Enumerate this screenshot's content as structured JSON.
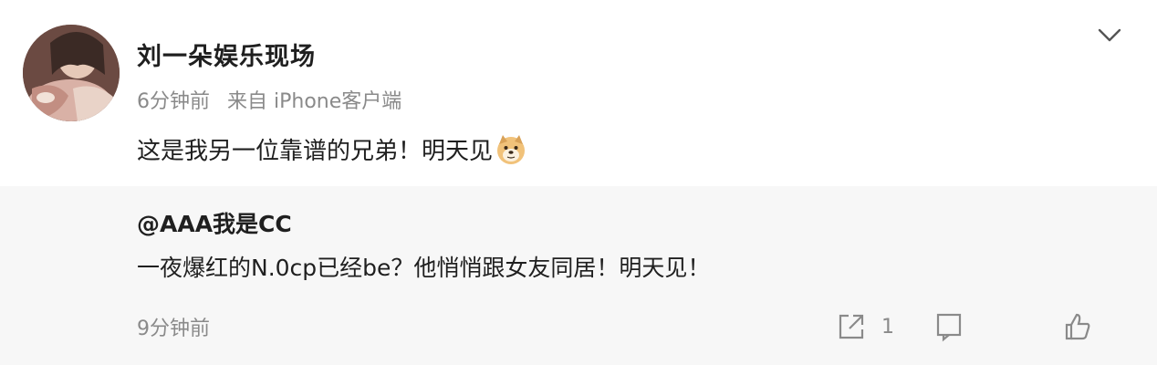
{
  "post": {
    "author": "刘一朵娱乐现场",
    "time": "6分钟前",
    "source": "来自 iPhone客户端",
    "text": "这是我另一位靠谱的兄弟！明天见",
    "emoji": "doge-emoji"
  },
  "repost": {
    "author": "@AAA我是CC",
    "text": "一夜爆红的N.0cp已经be？他悄悄跟女友同居！明天见！",
    "time": "9分钟前",
    "share_count": "1"
  },
  "icons": {
    "menu": "chevron-down-icon",
    "share": "share-icon",
    "comment": "comment-icon",
    "like": "like-icon"
  }
}
